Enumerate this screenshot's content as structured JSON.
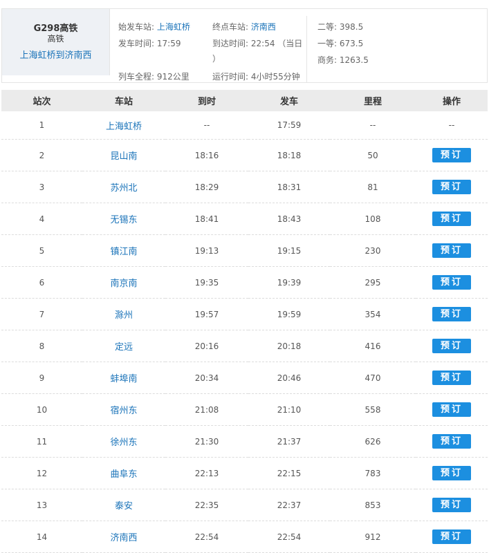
{
  "train": {
    "code": "G298高铁",
    "type": "高铁",
    "route": "上海虹桥到济南西",
    "start_label": "始发车站:",
    "start_station": "上海虹桥",
    "end_label": "终点车站:",
    "end_station": "济南西",
    "depart_label": "发车时间:",
    "depart_time": "17:59",
    "arrive_label": "到达时间:",
    "arrive_time": "22:54",
    "arrive_note": "（当日",
    "arrive_note_close": "）",
    "distance_label": "列车全程:",
    "distance": "912公里",
    "duration_label": "运行时间:",
    "duration": "4小时55分钟",
    "prices": [
      {
        "label": "二等:",
        "value": "398.5"
      },
      {
        "label": "一等:",
        "value": "673.5"
      },
      {
        "label": "商务:",
        "value": "1263.5"
      }
    ]
  },
  "table": {
    "headers": [
      "站次",
      "车站",
      "到时",
      "发车",
      "里程",
      "操作"
    ],
    "book_label": "预订",
    "rows": [
      {
        "no": "1",
        "station": "上海虹桥",
        "arrive": "--",
        "depart": "17:59",
        "km": "--",
        "op": "--"
      },
      {
        "no": "2",
        "station": "昆山南",
        "arrive": "18:16",
        "depart": "18:18",
        "km": "50"
      },
      {
        "no": "3",
        "station": "苏州北",
        "arrive": "18:29",
        "depart": "18:31",
        "km": "81"
      },
      {
        "no": "4",
        "station": "无锡东",
        "arrive": "18:41",
        "depart": "18:43",
        "km": "108"
      },
      {
        "no": "5",
        "station": "镇江南",
        "arrive": "19:13",
        "depart": "19:15",
        "km": "230"
      },
      {
        "no": "6",
        "station": "南京南",
        "arrive": "19:35",
        "depart": "19:39",
        "km": "295"
      },
      {
        "no": "7",
        "station": "滁州",
        "arrive": "19:57",
        "depart": "19:59",
        "km": "354"
      },
      {
        "no": "8",
        "station": "定远",
        "arrive": "20:16",
        "depart": "20:18",
        "km": "416"
      },
      {
        "no": "9",
        "station": "蚌埠南",
        "arrive": "20:34",
        "depart": "20:46",
        "km": "470"
      },
      {
        "no": "10",
        "station": "宿州东",
        "arrive": "21:08",
        "depart": "21:10",
        "km": "558"
      },
      {
        "no": "11",
        "station": "徐州东",
        "arrive": "21:30",
        "depart": "21:37",
        "km": "626"
      },
      {
        "no": "12",
        "station": "曲阜东",
        "arrive": "22:13",
        "depart": "22:15",
        "km": "783"
      },
      {
        "no": "13",
        "station": "泰安",
        "arrive": "22:35",
        "depart": "22:37",
        "km": "853"
      },
      {
        "no": "14",
        "station": "济南西",
        "arrive": "22:54",
        "depart": "22:54",
        "km": "912"
      }
    ]
  }
}
